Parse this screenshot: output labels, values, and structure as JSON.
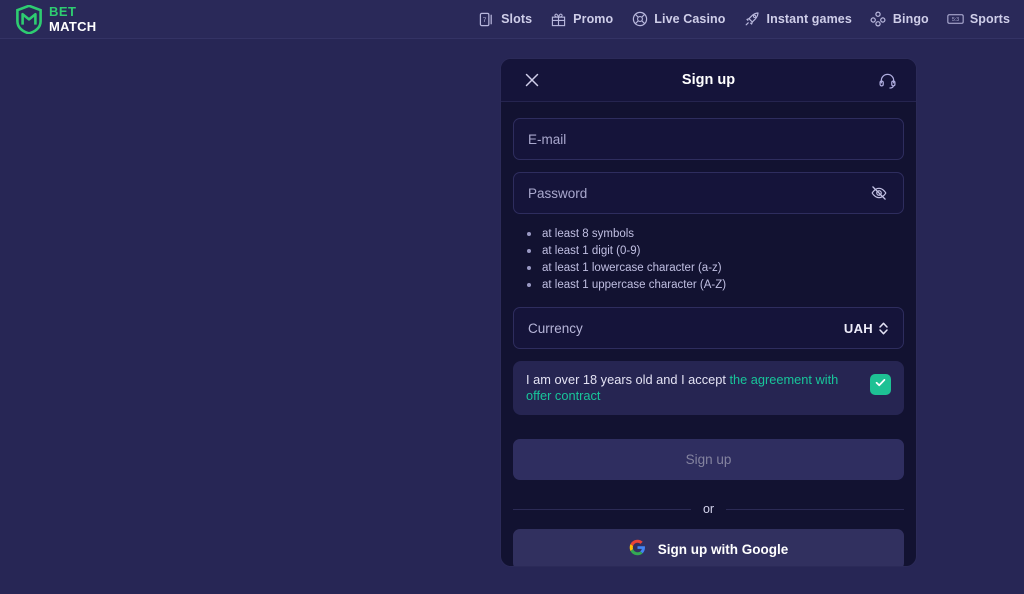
{
  "brand": {
    "logo_icon": "shield-m-logo-icon",
    "name_top": "BET",
    "name_bottom": "MATCH",
    "green": "#2ecc71"
  },
  "nav": {
    "items": [
      {
        "label": "Slots",
        "icon": "slot-card-icon"
      },
      {
        "label": "Promo",
        "icon": "gift-icon"
      },
      {
        "label": "Live Casino",
        "icon": "roulette-wheel-icon"
      },
      {
        "label": "Instant games",
        "icon": "rocket-icon"
      },
      {
        "label": "Bingo",
        "icon": "bingo-balls-icon"
      },
      {
        "label": "Sports",
        "icon": "scoreboard-icon"
      }
    ]
  },
  "modal": {
    "title": "Sign up",
    "close_icon": "close-icon",
    "support_icon": "headset-support-icon",
    "email": {
      "placeholder": "E-mail",
      "value": ""
    },
    "password": {
      "placeholder": "Password",
      "value": "",
      "toggle_icon": "eye-off-icon"
    },
    "password_rules": [
      "at least 8 symbols",
      "at least 1 digit (0-9)",
      "at least 1 lowercase character (a-z)",
      "at least 1 uppercase character (A-Z)"
    ],
    "currency": {
      "label": "Currency",
      "value": "UAH",
      "chevron_icon": "chevron-up-down-icon"
    },
    "agreement": {
      "text_prefix": "I am over 18 years old and I accept ",
      "link_text": "the agreement with offer contract",
      "checked": true,
      "check_icon": "checkmark-icon",
      "accent": "#1ec194"
    },
    "submit": {
      "label": "Sign up",
      "disabled": true
    },
    "divider_text": "or",
    "google": {
      "label": "Sign up with Google",
      "icon": "google-g-icon"
    }
  }
}
